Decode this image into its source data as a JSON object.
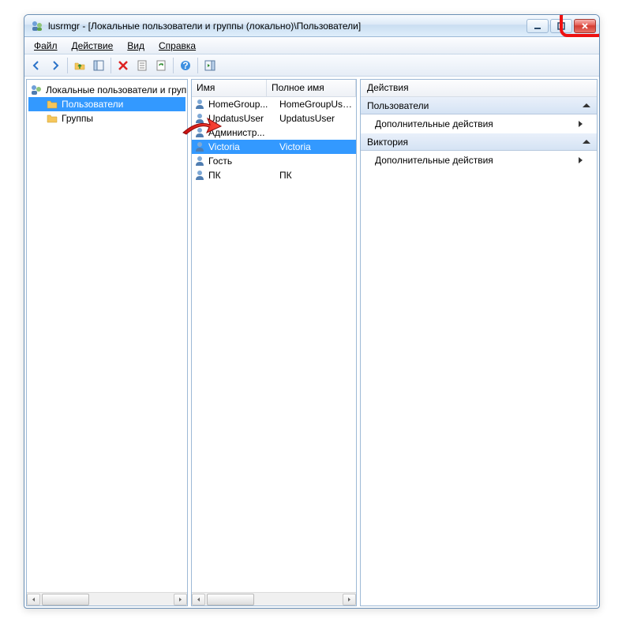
{
  "window": {
    "title": "lusrmgr - [Локальные пользователи и группы (локально)\\Пользователи]"
  },
  "menu": {
    "file": "Файл",
    "action": "Действие",
    "view": "Вид",
    "help": "Справка"
  },
  "tree": {
    "root": "Локальные пользователи и группы",
    "users": "Пользователи",
    "groups": "Группы"
  },
  "list": {
    "col_name": "Имя",
    "col_fullname": "Полное имя",
    "rows": [
      {
        "name": "HomeGroup...",
        "full": "HomeGroupUser$",
        "selected": false
      },
      {
        "name": "UpdatusUser",
        "full": "UpdatusUser",
        "selected": false
      },
      {
        "name": "Администр...",
        "full": "",
        "selected": false
      },
      {
        "name": "Victoria",
        "full": "Victoria",
        "selected": true
      },
      {
        "name": "Гость",
        "full": "",
        "selected": false
      },
      {
        "name": "ПК",
        "full": "ПК",
        "selected": false
      }
    ]
  },
  "actions": {
    "header": "Действия",
    "section1": "Пользователи",
    "item1": "Дополнительные действия",
    "section2": "Виктория",
    "item2": "Дополнительные действия"
  }
}
